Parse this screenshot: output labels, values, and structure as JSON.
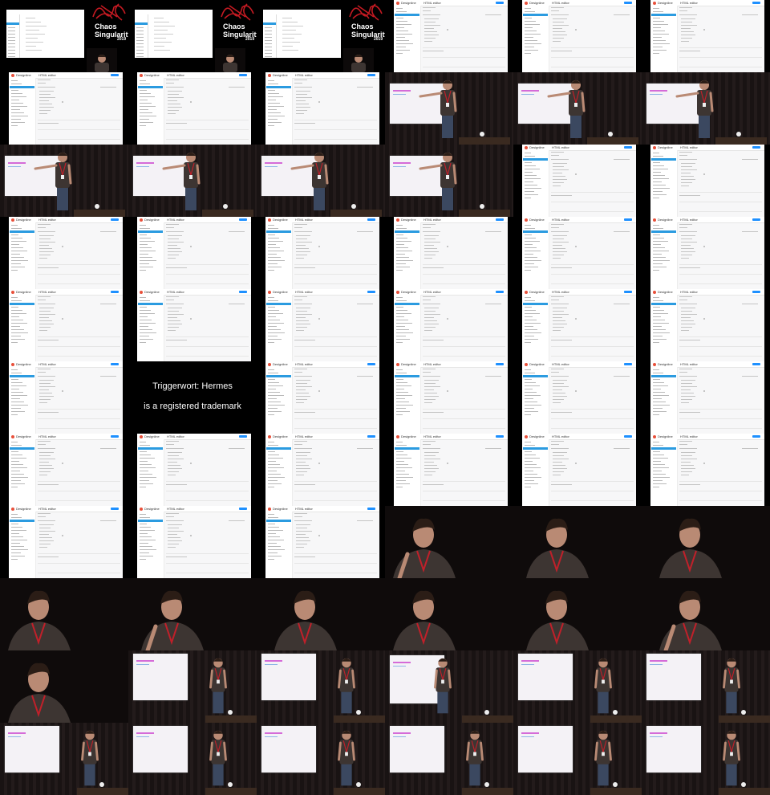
{
  "title_card": {
    "line1": "Chaos",
    "line2": "Singularity",
    "year": "2019"
  },
  "app": {
    "brand": "Designline",
    "page_title": "HTML editor"
  },
  "text_card": {
    "line1": "Triggerwort: Hermes",
    "line2": "is a registered trademark"
  },
  "colors": {
    "accent": "#2b9be0",
    "brand": "#e8503a",
    "lanyard": "#c0202a",
    "shirt": "#3d3532"
  },
  "grid": {
    "rows": [
      [
        "title",
        "title",
        "title",
        "app",
        "app",
        "app"
      ],
      [
        "app",
        "app",
        "app",
        "stage-point",
        "stage-point",
        "stage-point"
      ],
      [
        "stage-point",
        "stage-point",
        "stage-point",
        "stage-point",
        "app",
        "app"
      ],
      [
        "app",
        "app",
        "app",
        "app",
        "app",
        "app"
      ],
      [
        "app",
        "app",
        "app",
        "app",
        "app",
        "app"
      ],
      [
        "app",
        "text",
        "app",
        "app",
        "app",
        "app"
      ],
      [
        "app",
        "app",
        "app",
        "app",
        "app",
        "app"
      ],
      [
        "app",
        "app",
        "app",
        "close",
        "close",
        "close"
      ],
      [
        "close",
        "close",
        "close",
        "close",
        "close",
        "close"
      ],
      [
        "close",
        "stage-right",
        "stage-right",
        "stage-mid",
        "stage-right",
        "stage-right"
      ],
      [
        "stage-right",
        "stage-right",
        "stage-right",
        "stage-right",
        "stage-right",
        "stage-right"
      ]
    ]
  }
}
